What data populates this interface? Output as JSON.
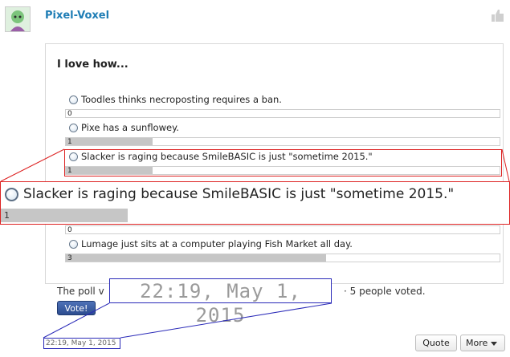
{
  "post": {
    "username": "Pixel-Voxel"
  },
  "poll": {
    "title": "I love how...",
    "options": [
      {
        "label": "Toodles thinks necroposting requires a ban.",
        "count": "0",
        "fraction": 0.0
      },
      {
        "label": "Pixe has a sunflowey.",
        "count": "1",
        "fraction": 0.2
      },
      {
        "label": "Slacker is raging because SmileBASIC is just \"sometime 2015.\"",
        "count": "1",
        "fraction": 0.2
      },
      {
        "label": "Lumage just sits at a computer playing Fish Market all day.",
        "count": "3",
        "fraction": 0.6
      }
    ],
    "hidden_count": "0",
    "zoomed_option_label": "Slacker is raging because SmileBASIC is just \"sometime 2015.\"",
    "zoomed_option_count": "1",
    "zoomed_option_fraction": 0.25,
    "footer_prefix": "The poll v",
    "footer_suffix": "· 5 people voted.",
    "vote_label": "Vote!"
  },
  "timestamp": {
    "zoomed": "22:19, May 1, 2015",
    "small": "22:19, May 1, 2015"
  },
  "actions": {
    "quote_label": "Quote",
    "more_label": "More"
  },
  "colors": {
    "username": "#1f7db5",
    "highlight_red": "#dd2222",
    "highlight_blue": "#2a2ab8",
    "bar_fill": "#c6c6c6"
  }
}
